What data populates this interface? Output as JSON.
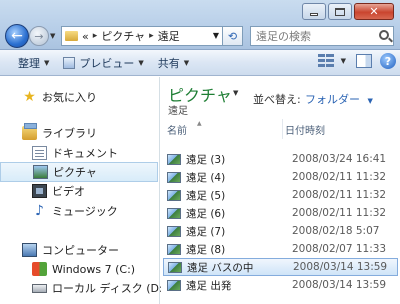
{
  "address": {
    "prefix": "«",
    "crumbs": [
      "ピクチャ",
      "遠足"
    ]
  },
  "search": {
    "placeholder": "遠足の検索"
  },
  "toolbar": {
    "organize": "整理",
    "preview": "プレビュー",
    "share": "共有"
  },
  "nav": {
    "favorites": "お気に入り",
    "libraries": "ライブラリ",
    "documents": "ドキュメント",
    "pictures": "ピクチャ",
    "videos": "ビデオ",
    "music": "ミュージック",
    "computer": "コンピューター",
    "drive_c": "Windows 7 (C:)",
    "drive_d": "ローカル ディスク (D:)"
  },
  "content": {
    "library_title": "ピクチャ",
    "library_subtitle": "遠足",
    "arrange_label": "並べ替え:",
    "arrange_value": "フォルダー",
    "col_name": "名前",
    "col_date": "日付時刻",
    "files": [
      {
        "name": "遠足 (3)",
        "date": "2008/03/24 16:41"
      },
      {
        "name": "遠足 (4)",
        "date": "2008/02/11 11:32"
      },
      {
        "name": "遠足 (5)",
        "date": "2008/02/11 11:32"
      },
      {
        "name": "遠足 (6)",
        "date": "2008/02/11 11:32"
      },
      {
        "name": "遠足 (7)",
        "date": "2008/02/18 5:07"
      },
      {
        "name": "遠足 (8)",
        "date": "2008/02/07 11:33"
      },
      {
        "name": "遠足 バスの中",
        "date": "2008/03/14 13:59"
      },
      {
        "name": "遠足 出発",
        "date": "2008/03/14 13:59"
      }
    ]
  }
}
